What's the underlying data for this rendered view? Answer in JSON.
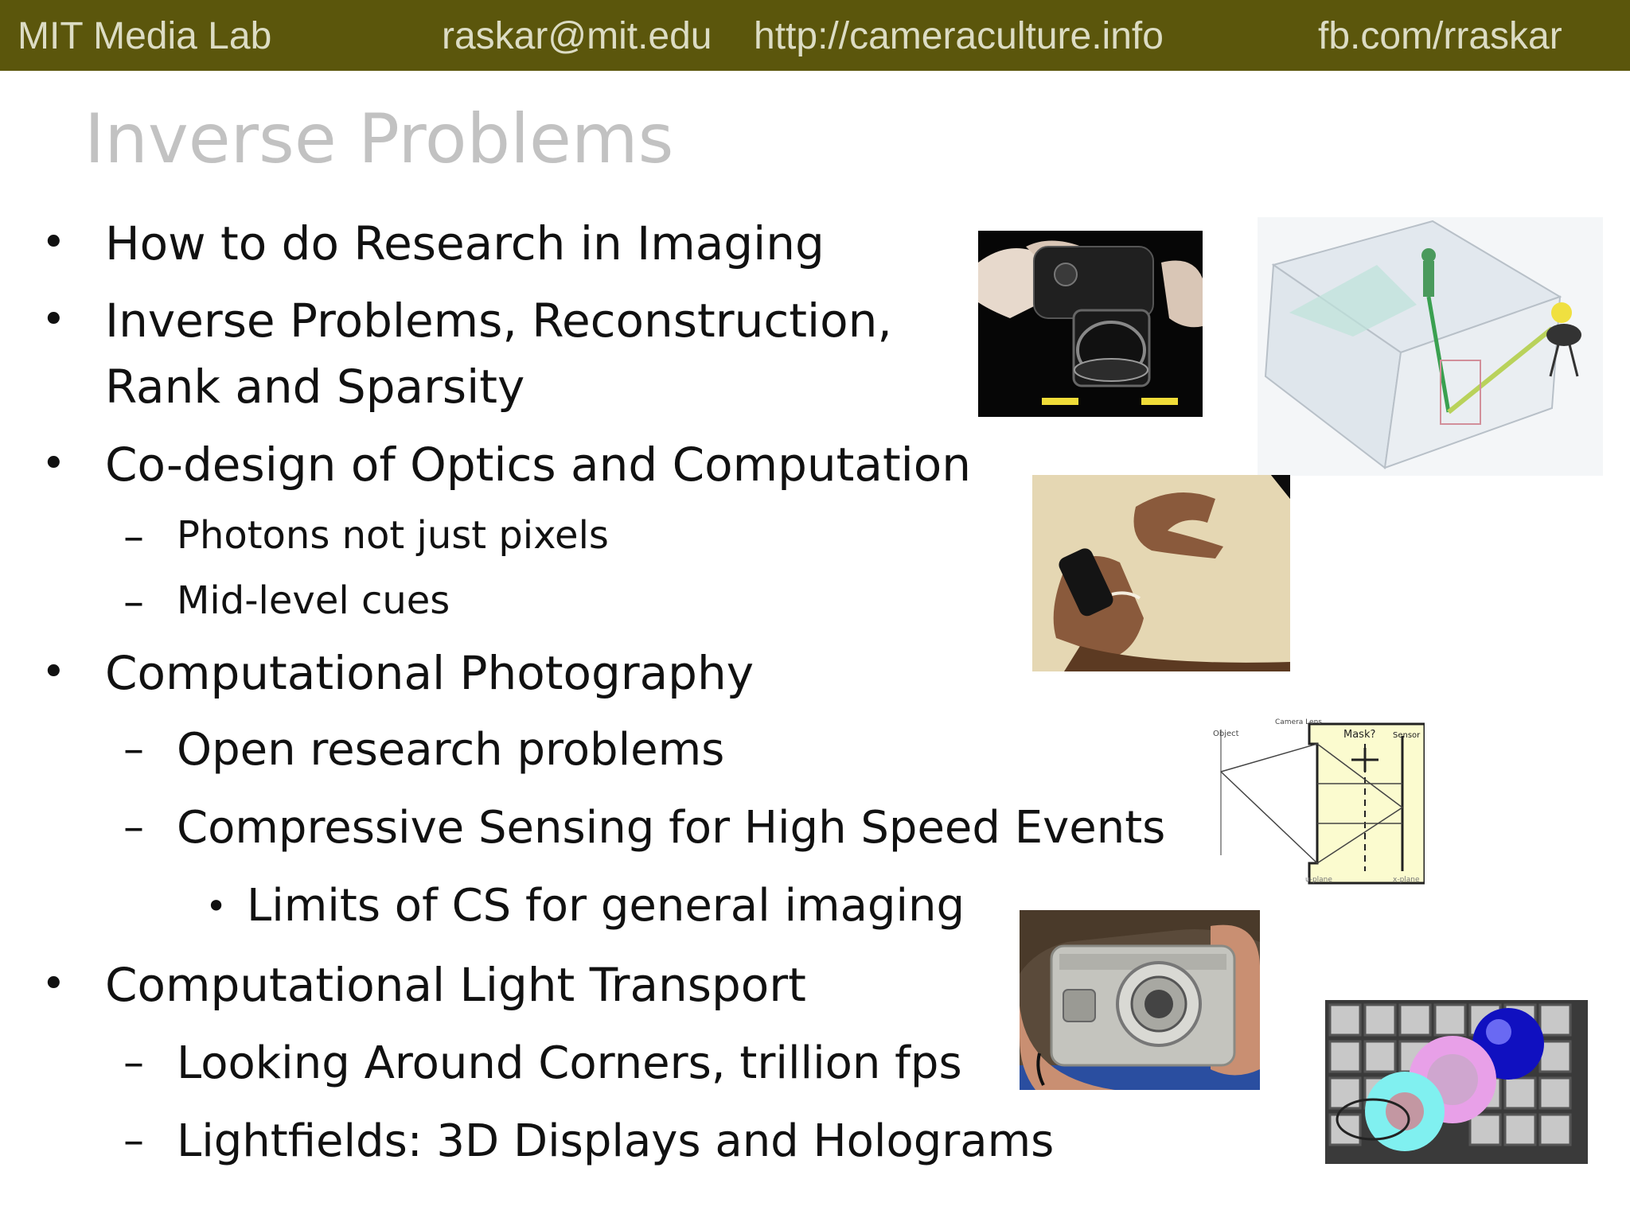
{
  "header": {
    "lab": "MIT Media Lab",
    "email": "raskar@mit.edu",
    "url": "http://cameraculture.info",
    "fb": "fb.com/rraskar"
  },
  "slide": {
    "title": "Inverse Problems",
    "bullets": [
      "How to do Research in Imaging",
      "Inverse Problems, Reconstruction,",
      "Rank and Sparsity",
      "Co-design of Optics and Computation",
      "Photons not just pixels",
      "Mid-level cues",
      "Computational Photography",
      "Open research problems",
      "Compressive Sensing for High Speed Events",
      "Limits of CS for general imaging",
      "Computational Light Transport",
      "Looking Around Corners, trillion fps",
      "Lightfields: 3D Displays and Holograms"
    ]
  },
  "diagram_labels": {
    "object": "Object",
    "lens": "Camera Lens",
    "mask": "Mask?",
    "sensor": "Sensor",
    "u_plane": "u-plane",
    "x_plane": "x-plane"
  },
  "colors": {
    "header_bg": "#5b560c",
    "header_text": "#dcdcc4",
    "title": "#c2c2c2"
  }
}
